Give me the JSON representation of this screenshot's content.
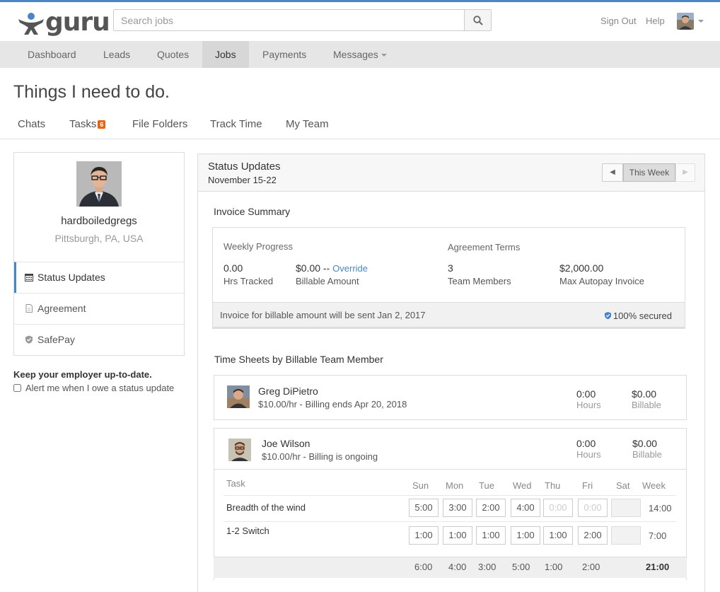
{
  "brand": {
    "name": "guru",
    "accent": "#4a86c5",
    "badge_color": "#e8630e"
  },
  "search": {
    "placeholder": "Search jobs",
    "icon": "search-icon"
  },
  "header": {
    "sign_out": "Sign Out",
    "help": "Help"
  },
  "nav": {
    "items": [
      "Dashboard",
      "Leads",
      "Quotes",
      "Jobs",
      "Payments",
      "Messages"
    ],
    "active": "Jobs"
  },
  "page": {
    "title": "Things I need to do."
  },
  "subtabs": {
    "items": [
      "Chats",
      "Tasks",
      "File Folders",
      "Track Time",
      "My Team"
    ],
    "tasks_badge": "6"
  },
  "profile": {
    "name": "hardboiledgregs",
    "location": "Pittsburgh, PA, USA"
  },
  "sidebar": {
    "items": [
      {
        "label": "Status Updates",
        "icon": "calendar-icon"
      },
      {
        "label": "Agreement",
        "icon": "document-icon"
      },
      {
        "label": "SafePay",
        "icon": "shield-icon"
      }
    ],
    "active": "Status Updates",
    "keep_title": "Keep your employer up-to-date.",
    "alert_label": "Alert me when I owe a status update"
  },
  "status": {
    "title": "Status Updates",
    "date_range": "November 15-22",
    "prev": "◀",
    "this_week": "This Week",
    "next": "▶"
  },
  "invoice": {
    "section_title": "Invoice Summary",
    "weekly_progress": "Weekly Progress",
    "agreement_terms": "Agreement Terms",
    "hrs_value": "0.00",
    "hrs_label": "Hrs Tracked",
    "billable_value": "$0.00",
    "billable_sep": " -- ",
    "override": "Override",
    "billable_label": "Billable Amount",
    "members_value": "3",
    "members_label": "Team Members",
    "autopay_value": "$2,000.00",
    "autopay_label": "Max Autopay Invoice",
    "footer": "Invoice for billable amount will be sent Jan 2, 2017",
    "secured": "100% secured"
  },
  "timesheets": {
    "section_title": "Time Sheets by Billable Team Member",
    "members": [
      {
        "name": "Greg DiPietro",
        "rate": "$10.00/hr",
        "billing": " - Billing ends Apr 20, 2018",
        "hours": "0:00",
        "hours_label": "Hours",
        "billable": "$0.00",
        "billable_label": "Billable"
      },
      {
        "name": "Joe Wilson",
        "rate": "$10.00/hr",
        "billing": " - Billing is ongoing",
        "hours": "0:00",
        "hours_label": "Hours",
        "billable": "$0.00",
        "billable_label": "Billable"
      }
    ],
    "columns": [
      "Task",
      "Sun",
      "Mon",
      "Tue",
      "Wed",
      "Thu",
      "Fri",
      "Sat",
      "Week"
    ],
    "rows": [
      {
        "task": "Breadth of the wind",
        "days": [
          "5:00",
          "3:00",
          "2:00",
          "4:00",
          "0:00",
          "0:00",
          ""
        ],
        "week": "14:00"
      },
      {
        "task": "1-2 Switch",
        "days": [
          "1:00",
          "1:00",
          "1:00",
          "1:00",
          "1:00",
          "2:00",
          ""
        ],
        "week": "7:00"
      }
    ],
    "totals": [
      "6:00",
      "4:00",
      "3:00",
      "5:00",
      "1:00",
      "2:00"
    ],
    "grand_total": "21:00"
  }
}
